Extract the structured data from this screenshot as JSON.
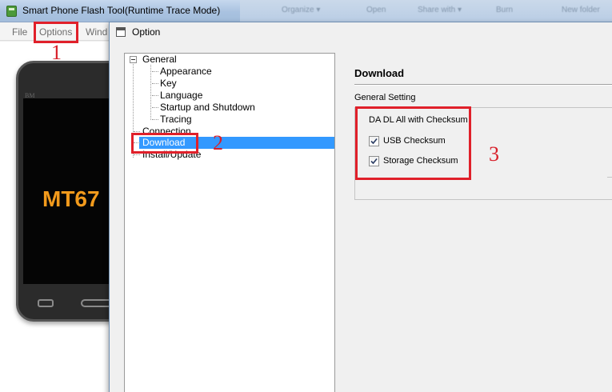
{
  "main_window": {
    "title": "Smart Phone Flash Tool(Runtime Trace Mode)",
    "menu": [
      "File",
      "Options",
      "Wind"
    ],
    "explorer_toolbar": [
      "Organize ▾",
      "Open",
      "Share with ▾",
      "Burn",
      "New folder"
    ]
  },
  "phone": {
    "brand": "BM",
    "model_text": "MT67"
  },
  "dialog": {
    "title": "Option",
    "tree": {
      "root": "General",
      "general_children": [
        "Appearance",
        "Key",
        "Language",
        "Startup and Shutdown",
        "Tracing"
      ],
      "others": [
        "Connection",
        "Download",
        "Install/Update"
      ],
      "selected": "Download"
    },
    "panel": {
      "title": "Download",
      "subtitle": "General Setting",
      "group_title": "DA DL All with Checksum",
      "checkboxes": [
        {
          "label": "USB Checksum",
          "checked": true
        },
        {
          "label": "Storage Checksum",
          "checked": true
        }
      ]
    }
  },
  "annotations": [
    "1",
    "2",
    "3"
  ],
  "colors": {
    "annotation": "#e0202a",
    "selection": "#3399ff",
    "phone_model": "#f29a1c"
  }
}
